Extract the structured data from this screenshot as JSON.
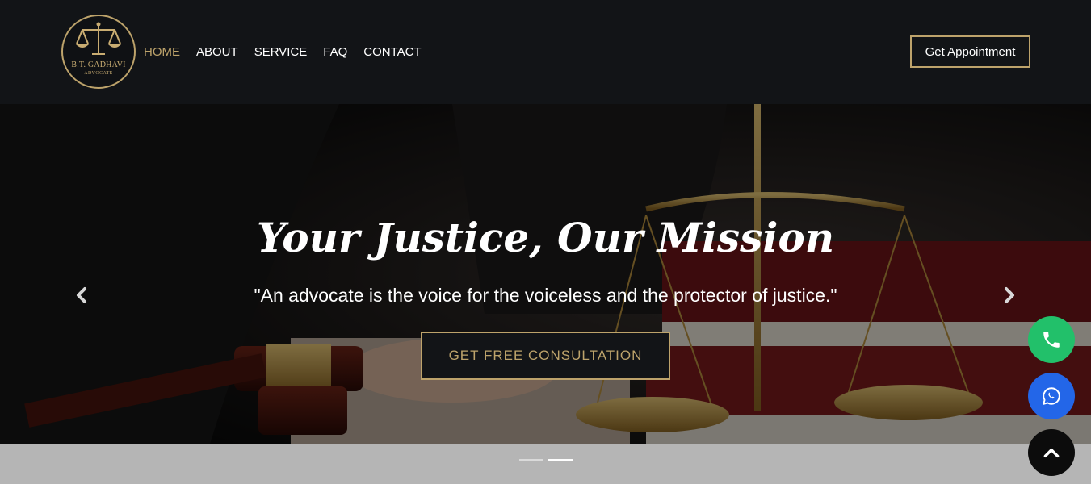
{
  "brand": {
    "name": "B.T. GADHAVI",
    "subtitle": "ADVOCATE",
    "accent_color": "#bda36b",
    "icon": "scales-of-justice-icon"
  },
  "nav": {
    "items": [
      {
        "label": "HOME",
        "active": true
      },
      {
        "label": "ABOUT",
        "active": false
      },
      {
        "label": "SERVICE",
        "active": false
      },
      {
        "label": "FAQ",
        "active": false
      },
      {
        "label": "CONTACT",
        "active": false
      }
    ],
    "appointment_label": "Get Appointment"
  },
  "hero": {
    "title": "Your Justice, Our Mission",
    "quote": "\"An advocate is the voice for the voiceless and the protector of justice.\"",
    "cta_label": "GET FREE CONSULTATION",
    "prev_icon": "chevron-left-icon",
    "next_icon": "chevron-right-icon",
    "slides_total": 2,
    "active_slide": 2
  },
  "floating": {
    "call_icon": "phone-icon",
    "call_color": "#22c06a",
    "whatsapp_icon": "whatsapp-icon",
    "whatsapp_color": "#2366e8",
    "top_icon": "chevron-up-icon"
  }
}
